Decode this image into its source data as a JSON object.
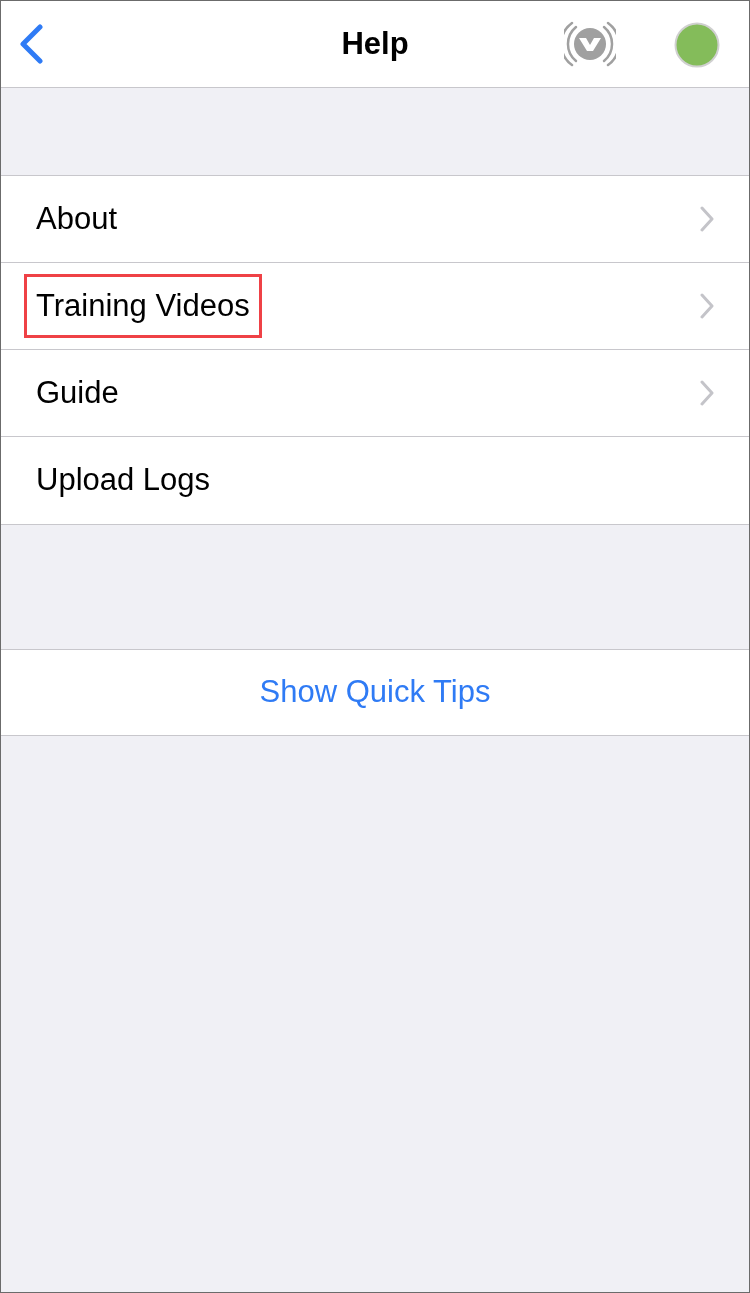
{
  "nav_bar": {
    "title": "Help"
  },
  "menu_items": [
    {
      "label": "About",
      "has_chevron": true,
      "highlighted": false
    },
    {
      "label": "Training Videos",
      "has_chevron": true,
      "highlighted": true
    },
    {
      "label": "Guide",
      "has_chevron": true,
      "highlighted": false
    },
    {
      "label": "Upload Logs",
      "has_chevron": false,
      "highlighted": false
    }
  ],
  "action_button": {
    "label": "Show Quick Tips"
  }
}
